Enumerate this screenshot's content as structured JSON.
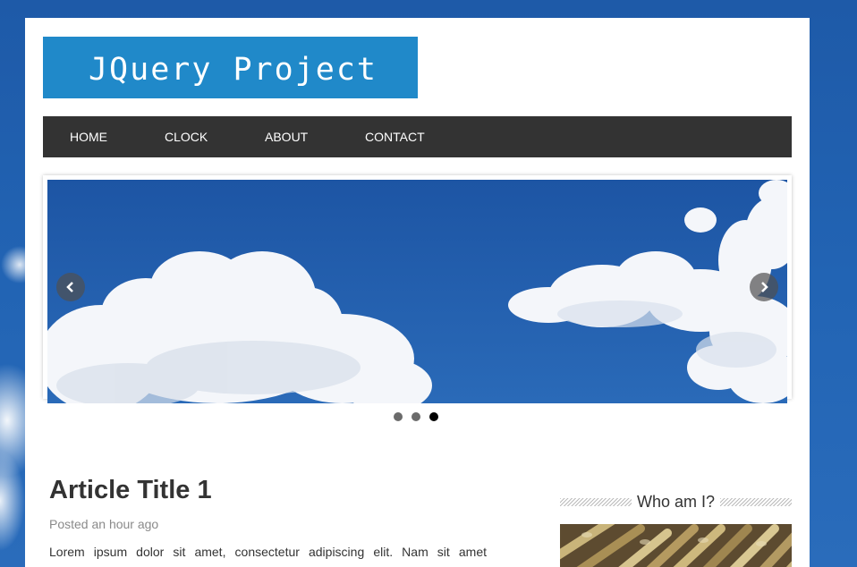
{
  "site": {
    "logo_text": "JQuery Project"
  },
  "nav": {
    "items": [
      {
        "label": "HOME"
      },
      {
        "label": "CLOCK"
      },
      {
        "label": "ABOUT"
      },
      {
        "label": "CONTACT"
      }
    ]
  },
  "slider": {
    "prev_icon": "chevron-left-icon",
    "next_icon": "chevron-right-icon",
    "dots": 3,
    "active_dot": 3
  },
  "article": {
    "title": "Article Title 1",
    "meta": "Posted an hour ago",
    "body": "Lorem ipsum dolor sit amet, consectetur adipiscing elit. Nam sit amet"
  },
  "sidebar": {
    "widget_title": "Who am I?"
  },
  "colors": {
    "logo_bg": "#2089c9",
    "nav_bg": "#333333",
    "page_bg": "#1f5fae"
  }
}
